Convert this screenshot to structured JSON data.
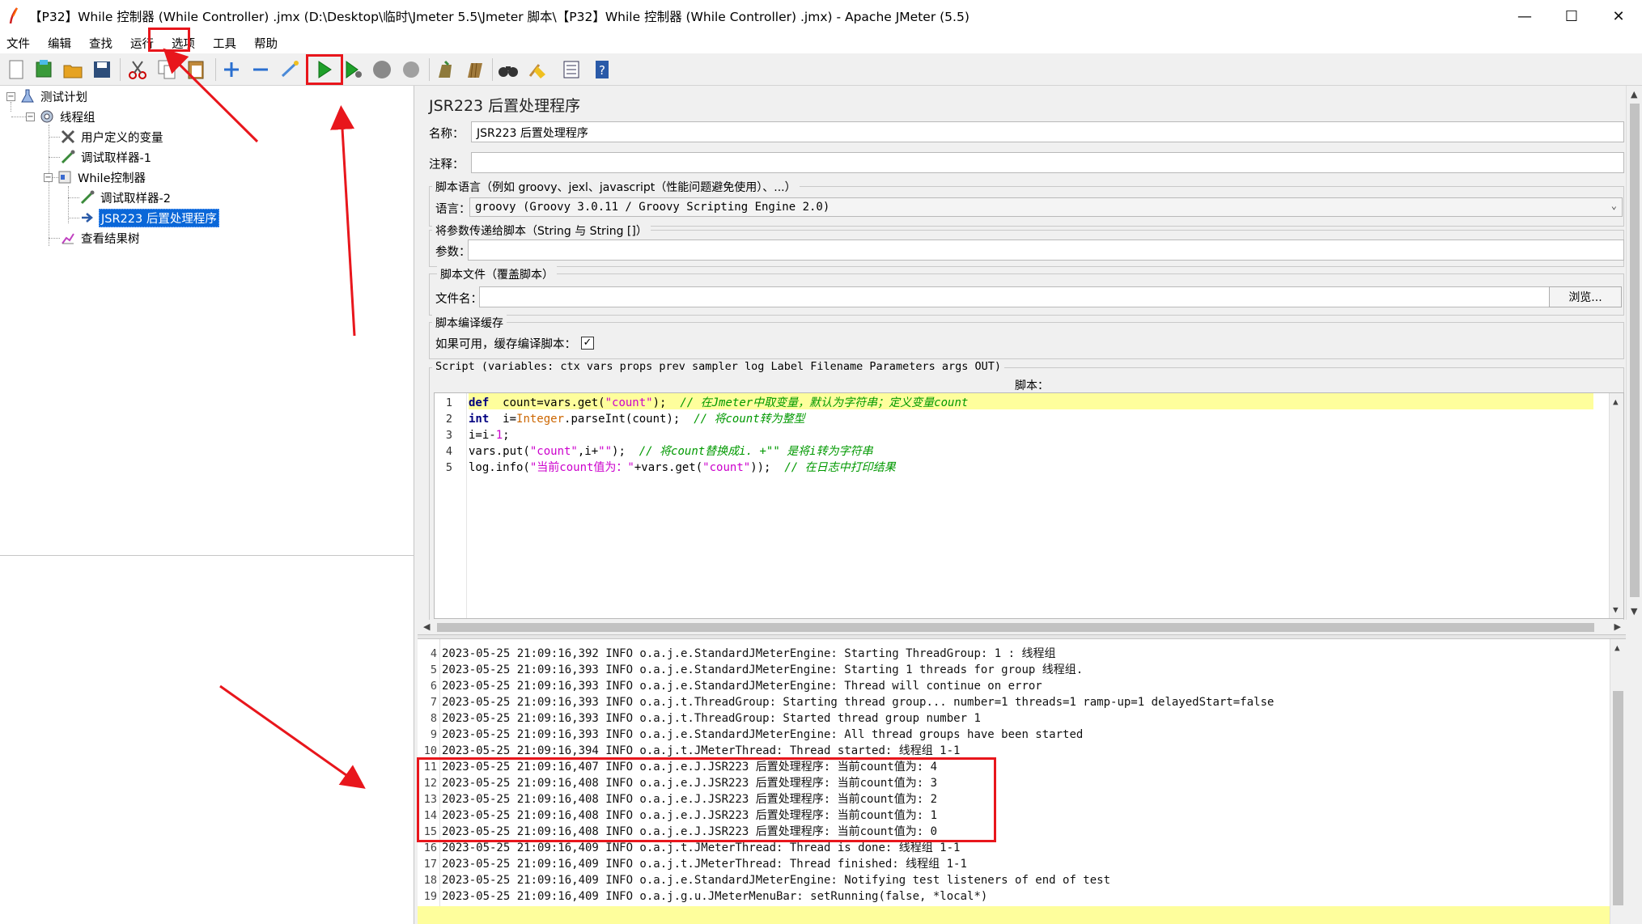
{
  "window": {
    "title": "【P32】While 控制器 (While Controller) .jmx (D:\\Desktop\\临时\\Jmeter 5.5\\Jmeter 脚本\\【P32】While 控制器 (While Controller) .jmx) - Apache JMeter (5.5)",
    "minimize": "—",
    "maximize": "☐",
    "close": "✕"
  },
  "menu": [
    "文件",
    "编辑",
    "查找",
    "运行",
    "选项",
    "工具",
    "帮助"
  ],
  "tree": {
    "root": "测试计划",
    "thread_group": "线程组",
    "user_vars": "用户定义的变量",
    "debug1": "调试取样器-1",
    "while": "While控制器",
    "debug2": "调试取样器-2",
    "jsr223": "JSR223 后置处理程序",
    "results": "查看结果树"
  },
  "panel": {
    "title": "JSR223 后置处理程序",
    "name_label": "名称：",
    "name_value": "JSR223 后置处理程序",
    "comment_label": "注释：",
    "lang_group": "脚本语言（例如 groovy、jexl、javascript（性能问题避免使用）、...）",
    "lang_label": "语言：",
    "lang_value": "groovy     (Groovy 3.0.11 / Groovy Scripting Engine 2.0)",
    "params_group": "将参数传递给脚本（String 与 String []）",
    "params_label": "参数：",
    "file_group": "脚本文件（覆盖脚本）",
    "file_label": "文件名：",
    "browse": "浏览...",
    "cache_group": "脚本编译缓存",
    "cache_label": "如果可用，缓存编译脚本：",
    "cache_checked": "✓",
    "script_group": "Script (variables: ctx vars props prev sampler log Label Filename Parameters args OUT)",
    "script_label": "脚本："
  },
  "code": [
    {
      "n": "1",
      "parts": [
        [
          "kw",
          "def"
        ],
        [
          "",
          "  count=vars.get("
        ],
        [
          "str",
          "\"count\""
        ],
        [
          "",
          ");  "
        ],
        [
          "cmt",
          "// 在Jmeter中取变量，默认为字符串；定义变量count"
        ]
      ]
    },
    {
      "n": "2",
      "parts": [
        [
          "kw",
          "int"
        ],
        [
          "",
          "  i="
        ],
        [
          "typ",
          "Integer"
        ],
        [
          "",
          ".parseInt(count);  "
        ],
        [
          "cmt",
          "// 将count转为整型"
        ]
      ]
    },
    {
      "n": "3",
      "parts": [
        [
          "",
          "i=i-"
        ],
        [
          "str",
          "1"
        ],
        [
          "",
          ";"
        ]
      ]
    },
    {
      "n": "4",
      "parts": [
        [
          "",
          "vars.put("
        ],
        [
          "str",
          "\"count\""
        ],
        [
          "",
          ",i+"
        ],
        [
          "str",
          "\"\""
        ],
        [
          "",
          ");  "
        ],
        [
          "cmt",
          "// 将count替换成i. +\"\" 是将i转为字符串"
        ]
      ]
    },
    {
      "n": "5",
      "parts": [
        [
          "",
          "log.info("
        ],
        [
          "str",
          "\"当前count值为：\""
        ],
        [
          "",
          "+vars.get("
        ],
        [
          "str",
          "\"count\""
        ],
        [
          "",
          "));  "
        ],
        [
          "cmt",
          "// 在日志中打印结果"
        ]
      ]
    }
  ],
  "log": [
    {
      "n": "4",
      "text": "2023-05-25 21:09:16,392 INFO o.a.j.e.StandardJMeterEngine: Starting ThreadGroup: 1 : 线程组"
    },
    {
      "n": "5",
      "text": "2023-05-25 21:09:16,393 INFO o.a.j.e.StandardJMeterEngine: Starting 1 threads for group 线程组."
    },
    {
      "n": "6",
      "text": "2023-05-25 21:09:16,393 INFO o.a.j.e.StandardJMeterEngine: Thread will continue on error"
    },
    {
      "n": "7",
      "text": "2023-05-25 21:09:16,393 INFO o.a.j.t.ThreadGroup: Starting thread group... number=1 threads=1 ramp-up=1 delayedStart=false"
    },
    {
      "n": "8",
      "text": "2023-05-25 21:09:16,393 INFO o.a.j.t.ThreadGroup: Started thread group number 1"
    },
    {
      "n": "9",
      "text": "2023-05-25 21:09:16,393 INFO o.a.j.e.StandardJMeterEngine: All thread groups have been started"
    },
    {
      "n": "10",
      "text": "2023-05-25 21:09:16,394 INFO o.a.j.t.JMeterThread: Thread started: 线程组 1-1"
    },
    {
      "n": "11",
      "text": "2023-05-25 21:09:16,407 INFO o.a.j.e.J.JSR223 后置处理程序: 当前count值为: 4"
    },
    {
      "n": "12",
      "text": "2023-05-25 21:09:16,408 INFO o.a.j.e.J.JSR223 后置处理程序: 当前count值为: 3"
    },
    {
      "n": "13",
      "text": "2023-05-25 21:09:16,408 INFO o.a.j.e.J.JSR223 后置处理程序: 当前count值为: 2"
    },
    {
      "n": "14",
      "text": "2023-05-25 21:09:16,408 INFO o.a.j.e.J.JSR223 后置处理程序: 当前count值为: 1"
    },
    {
      "n": "15",
      "text": "2023-05-25 21:09:16,408 INFO o.a.j.e.J.JSR223 后置处理程序: 当前count值为: 0"
    },
    {
      "n": "16",
      "text": "2023-05-25 21:09:16,409 INFO o.a.j.t.JMeterThread: Thread is done: 线程组 1-1"
    },
    {
      "n": "17",
      "text": "2023-05-25 21:09:16,409 INFO o.a.j.t.JMeterThread: Thread finished: 线程组 1-1"
    },
    {
      "n": "18",
      "text": "2023-05-25 21:09:16,409 INFO o.a.j.e.StandardJMeterEngine: Notifying test listeners of end of test"
    },
    {
      "n": "19",
      "text": "2023-05-25 21:09:16,409 INFO o.a.j.g.u.JMeterMenuBar: setRunning(false, *local*)"
    },
    {
      "n": "20",
      "text": ""
    }
  ],
  "colors": {
    "annotation": "#e8161c",
    "selection": "#0a67d8",
    "highlight_line": "#fefe9c"
  }
}
